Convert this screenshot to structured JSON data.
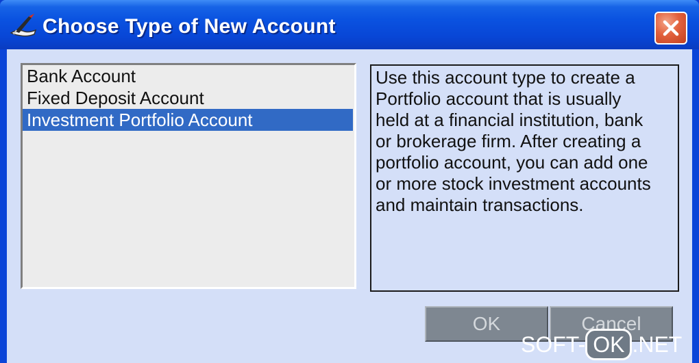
{
  "window": {
    "title": "Choose Type of New Account",
    "icon": "app-quill-icon",
    "close_icon": "close-icon"
  },
  "account_types": {
    "items": [
      {
        "label": "Bank Account",
        "selected": false
      },
      {
        "label": "Fixed Deposit Account",
        "selected": false
      },
      {
        "label": "Investment Portfolio Account",
        "selected": true
      }
    ]
  },
  "description": {
    "lines": [
      "Use this account type to create a",
      "Portfolio account that is usually",
      "held at a financial institution, bank",
      "or brokerage firm. After creating a",
      "portfolio account, you can add one",
      "or more stock investment accounts",
      "and maintain transactions."
    ]
  },
  "buttons": {
    "ok_label": "OK",
    "cancel_label": "Cancel"
  },
  "watermark": {
    "left": "SOFT-",
    "box": "OK",
    "right": ".NET"
  },
  "colors": {
    "title_bar": "#0a52e0",
    "selection": "#316ac5",
    "close_button": "#e2613d",
    "dialog_background": "#d4dff8"
  }
}
